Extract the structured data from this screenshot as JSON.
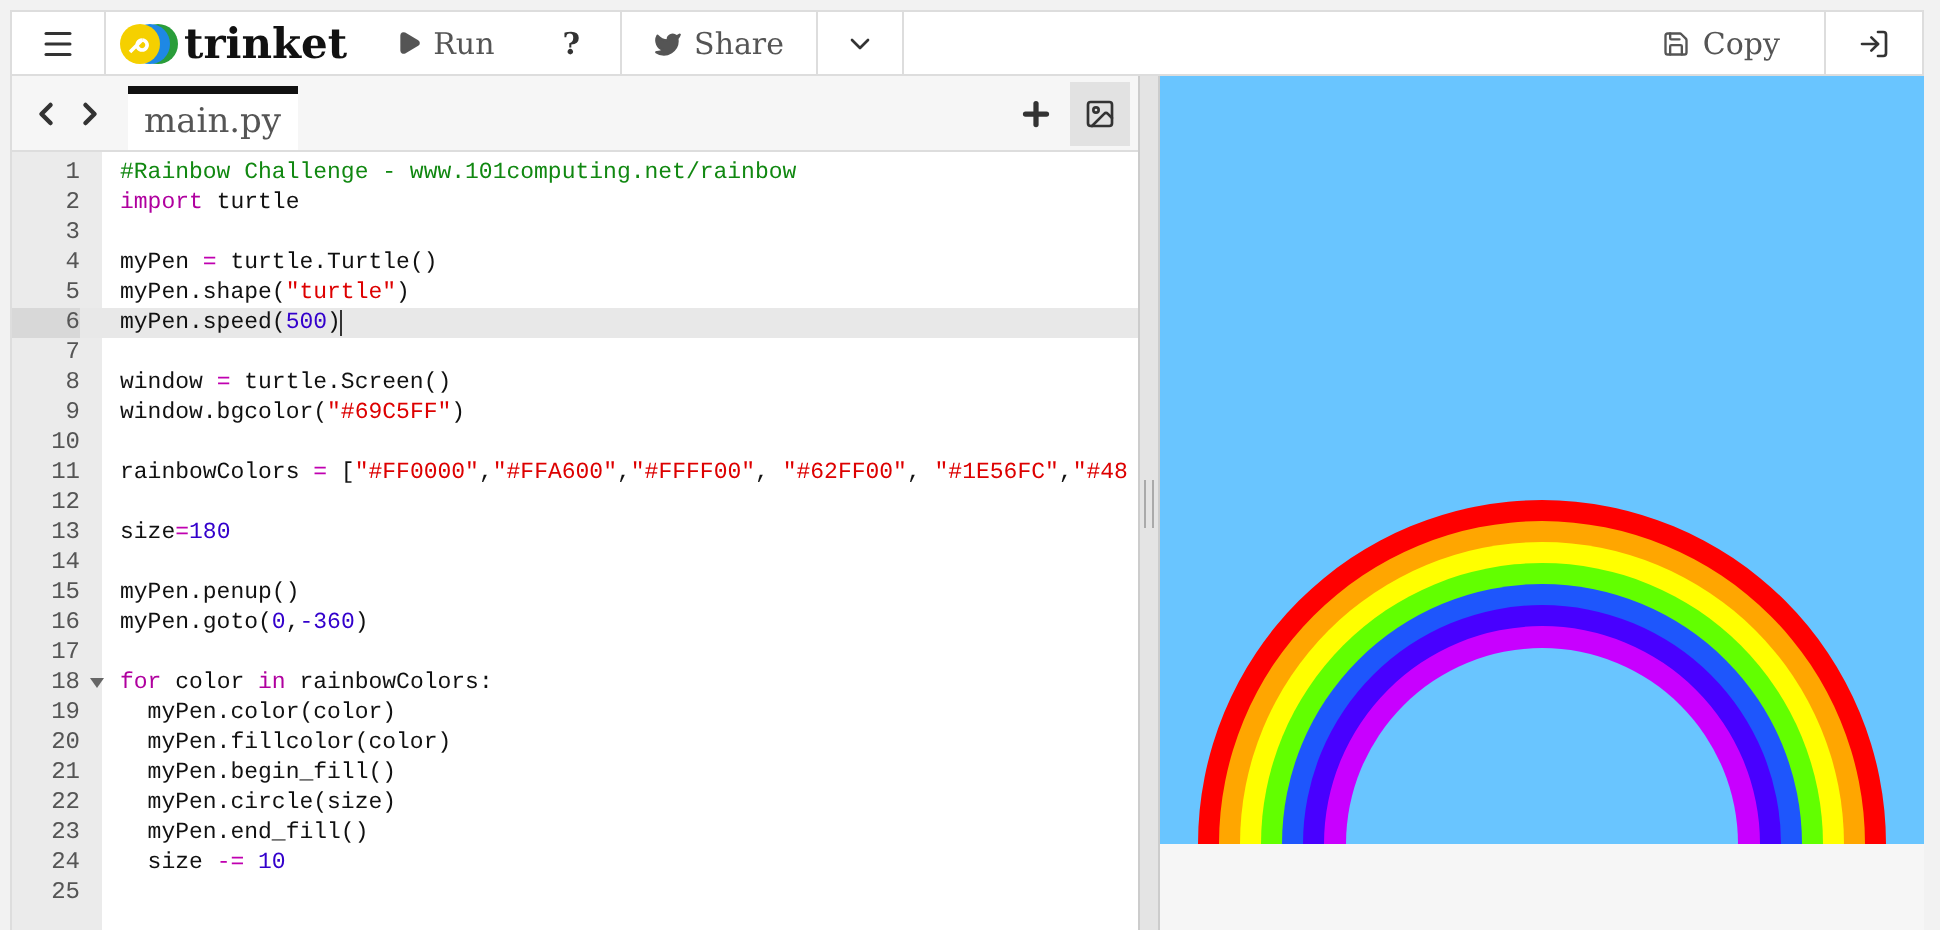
{
  "toolbar": {
    "brand": "trinket",
    "run": "Run",
    "help": "?",
    "share": "Share",
    "copy": "Copy"
  },
  "editor": {
    "files": [
      {
        "name": "main.py",
        "selected": true
      }
    ],
    "lines": [
      {
        "number": "1",
        "selected": false,
        "foldable": false,
        "tokens": [
          {
            "kind": "comment",
            "text": "#Rainbow Challenge - www.101computing.net/rainbow"
          }
        ]
      },
      {
        "number": "2",
        "selected": false,
        "foldable": false,
        "tokens": [
          {
            "kind": "keyword",
            "text": "import"
          },
          {
            "kind": "plain",
            "text": " turtle"
          }
        ]
      },
      {
        "number": "3",
        "selected": false,
        "foldable": false
      },
      {
        "number": "4",
        "selected": false,
        "foldable": false,
        "tokens": [
          {
            "kind": "plain",
            "text": "myPen "
          },
          {
            "kind": "operator",
            "text": "="
          },
          {
            "kind": "plain",
            "text": " turtle.Turtle()"
          }
        ]
      },
      {
        "number": "5",
        "selected": false,
        "foldable": false,
        "tokens": [
          {
            "kind": "plain",
            "text": "myPen.shape("
          },
          {
            "kind": "string",
            "text": "\"turtle\""
          },
          {
            "kind": "plain",
            "text": ")"
          }
        ]
      },
      {
        "number": "6",
        "selected": true,
        "foldable": false,
        "tokens": [
          {
            "kind": "plain",
            "text": "myPen.speed("
          },
          {
            "kind": "number",
            "text": "500"
          },
          {
            "kind": "plain",
            "text": ")"
          }
        ]
      },
      {
        "number": "7",
        "selected": false,
        "foldable": false
      },
      {
        "number": "8",
        "selected": false,
        "foldable": false,
        "tokens": [
          {
            "kind": "plain",
            "text": "window "
          },
          {
            "kind": "operator",
            "text": "="
          },
          {
            "kind": "plain",
            "text": " turtle.Screen()"
          }
        ]
      },
      {
        "number": "9",
        "selected": false,
        "foldable": false,
        "tokens": [
          {
            "kind": "plain",
            "text": "window.bgcolor("
          },
          {
            "kind": "string",
            "text": "\"#69C5FF\""
          },
          {
            "kind": "plain",
            "text": ")"
          }
        ]
      },
      {
        "number": "10",
        "selected": false,
        "foldable": false
      },
      {
        "number": "11",
        "selected": false,
        "foldable": false,
        "tokens": [
          {
            "kind": "plain",
            "text": "rainbowColors "
          },
          {
            "kind": "operator",
            "text": "="
          },
          {
            "kind": "plain",
            "text": " ["
          },
          {
            "kind": "string",
            "text": "\"#FF0000\""
          },
          {
            "kind": "plain",
            "text": ","
          },
          {
            "kind": "string",
            "text": "\"#FFA600\""
          },
          {
            "kind": "plain",
            "text": ","
          },
          {
            "kind": "string",
            "text": "\"#FFFF00\""
          },
          {
            "kind": "plain",
            "text": ", "
          },
          {
            "kind": "string",
            "text": "\"#62FF00\""
          },
          {
            "kind": "plain",
            "text": ", "
          },
          {
            "kind": "string",
            "text": "\"#1E56FC\""
          },
          {
            "kind": "plain",
            "text": ","
          },
          {
            "kind": "string",
            "text": "\"#48"
          }
        ]
      },
      {
        "number": "12",
        "selected": false,
        "foldable": false
      },
      {
        "number": "13",
        "selected": false,
        "foldable": false,
        "tokens": [
          {
            "kind": "plain",
            "text": "size"
          },
          {
            "kind": "operator",
            "text": "="
          },
          {
            "kind": "number",
            "text": "180"
          }
        ]
      },
      {
        "number": "14",
        "selected": false,
        "foldable": false
      },
      {
        "number": "15",
        "selected": false,
        "foldable": false,
        "tokens": [
          {
            "kind": "plain",
            "text": "myPen.penup()"
          }
        ]
      },
      {
        "number": "16",
        "selected": false,
        "foldable": false,
        "tokens": [
          {
            "kind": "plain",
            "text": "myPen.goto("
          },
          {
            "kind": "number",
            "text": "0"
          },
          {
            "kind": "plain",
            "text": ","
          },
          {
            "kind": "number",
            "text": "-360"
          },
          {
            "kind": "plain",
            "text": ")"
          }
        ]
      },
      {
        "number": "17",
        "selected": false,
        "foldable": false
      },
      {
        "number": "18",
        "selected": false,
        "foldable": true,
        "tokens": [
          {
            "kind": "keyword",
            "text": "for"
          },
          {
            "kind": "plain",
            "text": " color "
          },
          {
            "kind": "keyword",
            "text": "in"
          },
          {
            "kind": "plain",
            "text": " rainbowColors:"
          }
        ]
      },
      {
        "number": "19",
        "selected": false,
        "foldable": false,
        "tokens": [
          {
            "kind": "plain",
            "text": "  myPen.color(color)"
          }
        ]
      },
      {
        "number": "20",
        "selected": false,
        "foldable": false,
        "tokens": [
          {
            "kind": "plain",
            "text": "  myPen.fillcolor(color)"
          }
        ]
      },
      {
        "number": "21",
        "selected": false,
        "foldable": false,
        "tokens": [
          {
            "kind": "plain",
            "text": "  myPen.begin_fill()"
          }
        ]
      },
      {
        "number": "22",
        "selected": false,
        "foldable": false,
        "tokens": [
          {
            "kind": "plain",
            "text": "  myPen.circle(size)"
          }
        ]
      },
      {
        "number": "23",
        "selected": false,
        "foldable": false,
        "tokens": [
          {
            "kind": "plain",
            "text": "  myPen.end_fill()"
          }
        ]
      },
      {
        "number": "24",
        "selected": false,
        "foldable": false,
        "tokens": [
          {
            "kind": "plain",
            "text": "  size "
          },
          {
            "kind": "operator",
            "text": "-="
          },
          {
            "kind": "number",
            "text": " 10"
          }
        ]
      },
      {
        "number": "25",
        "selected": false,
        "foldable": false
      }
    ]
  }
}
